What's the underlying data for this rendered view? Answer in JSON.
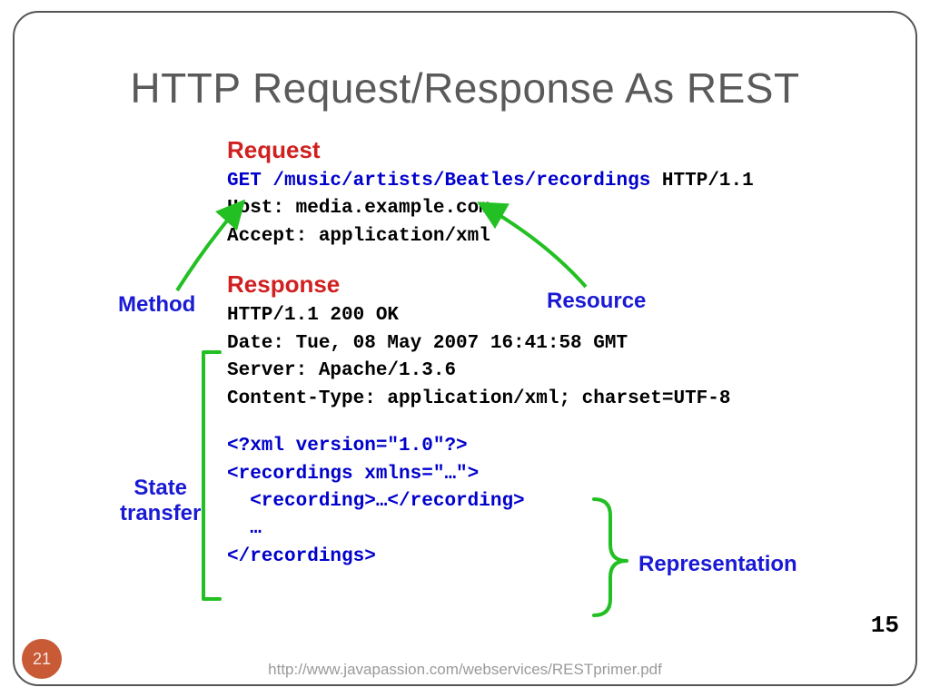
{
  "title": "HTTP Request/Response As REST",
  "labels": {
    "request": "Request",
    "response": "Response",
    "method": "Method",
    "resource": "Resource",
    "state": "State\ntransfer",
    "representation": "Representation"
  },
  "request": {
    "method": "GET",
    "path": "/music/artists/Beatles/recordings",
    "version": "HTTP/1.1",
    "host_line": "Host: media.example.com",
    "accept_line": "Accept: application/xml"
  },
  "response": {
    "status_line": "HTTP/1.1 200 OK",
    "date_line": "Date: Tue, 08 May 2007 16:41:58 GMT",
    "server_line": "Server: Apache/1.3.6",
    "ct_line": "Content-Type: application/xml; charset=UTF-8",
    "xml1": "<?xml version=\"1.0\"?>",
    "xml2": "<recordings xmlns=\"…\">",
    "xml3": "  <recording>…</recording>",
    "xml4": "  …",
    "xml5": "</recordings>"
  },
  "footer": {
    "url": "http://www.javapassion.com/webservices/RESTprimer.pdf",
    "page": "21",
    "inner_page": "15"
  }
}
